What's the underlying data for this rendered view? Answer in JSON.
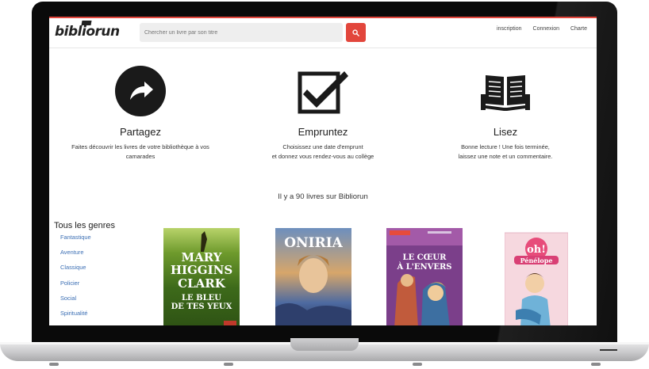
{
  "app": {
    "logo_text": "bibliorun"
  },
  "search": {
    "placeholder": "Chercher un livre par son titre",
    "button_icon": "search-icon"
  },
  "nav": {
    "items": [
      {
        "label": "inscription"
      },
      {
        "label": "Connexion"
      },
      {
        "label": "Charte"
      }
    ]
  },
  "features": [
    {
      "icon": "share-icon",
      "title": "Partagez",
      "line1": "Faites découvrir les livres de votre bibliothèque à vos",
      "line2": "camarades"
    },
    {
      "icon": "checkbox-icon",
      "title": "Empruntez",
      "line1": "Choisissez une date d'emprunt",
      "line2": "et donnez vous rendez-vous au collège"
    },
    {
      "icon": "book-icon",
      "title": "Lisez",
      "line1": "Bonne lecture ! Une fois terminée,",
      "line2": "laissez une note et un commentaire."
    }
  ],
  "catalog": {
    "count_text": "Il y a 90 livres sur Bibliorun"
  },
  "genres": {
    "title": "Tous les genres",
    "items": [
      {
        "label": "Fantastique"
      },
      {
        "label": "Aventure"
      },
      {
        "label": "Classique"
      },
      {
        "label": "Policier"
      },
      {
        "label": "Social"
      },
      {
        "label": "Spiritualité"
      }
    ]
  },
  "books": [
    {
      "cover_lines": [
        "MARY",
        "HIGGINS",
        "CLARK",
        "LE BLEU",
        "DE TES YEUX"
      ]
    },
    {
      "cover_lines": [
        "ONIRIA"
      ]
    },
    {
      "cover_lines": [
        "LE CŒUR",
        "À L'ENVERS"
      ]
    },
    {
      "cover_lines": [
        "oh!",
        "Pénélope"
      ]
    }
  ],
  "colors": {
    "accent": "#e2463c",
    "link": "#3c6fb4"
  }
}
